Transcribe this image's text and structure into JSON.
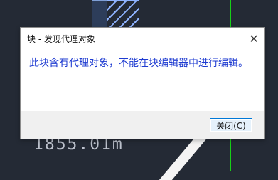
{
  "background": {
    "cad_text": "1855.01m"
  },
  "dialog": {
    "title": "块 - 发现代理对象",
    "message": "此块含有代理对象，不能在块编辑器中进行编辑。",
    "close_button_label": "关闭(C)"
  },
  "icons": {
    "close": "close-icon"
  },
  "colors": {
    "message": "#1e3bd1",
    "button_border": "#0078d7"
  }
}
